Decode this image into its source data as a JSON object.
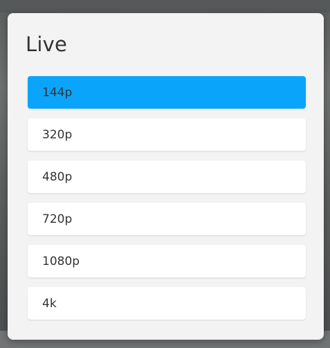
{
  "dialog": {
    "title": "Live"
  },
  "quality_options": [
    {
      "label": "144p",
      "selected": true
    },
    {
      "label": "320p",
      "selected": false
    },
    {
      "label": "480p",
      "selected": false
    },
    {
      "label": "720p",
      "selected": false
    },
    {
      "label": "1080p",
      "selected": false
    },
    {
      "label": "4k",
      "selected": false
    }
  ],
  "colors": {
    "selected_background": "#0aa5fa",
    "option_background": "#ffffff",
    "dialog_background": "#f3f3f3"
  }
}
